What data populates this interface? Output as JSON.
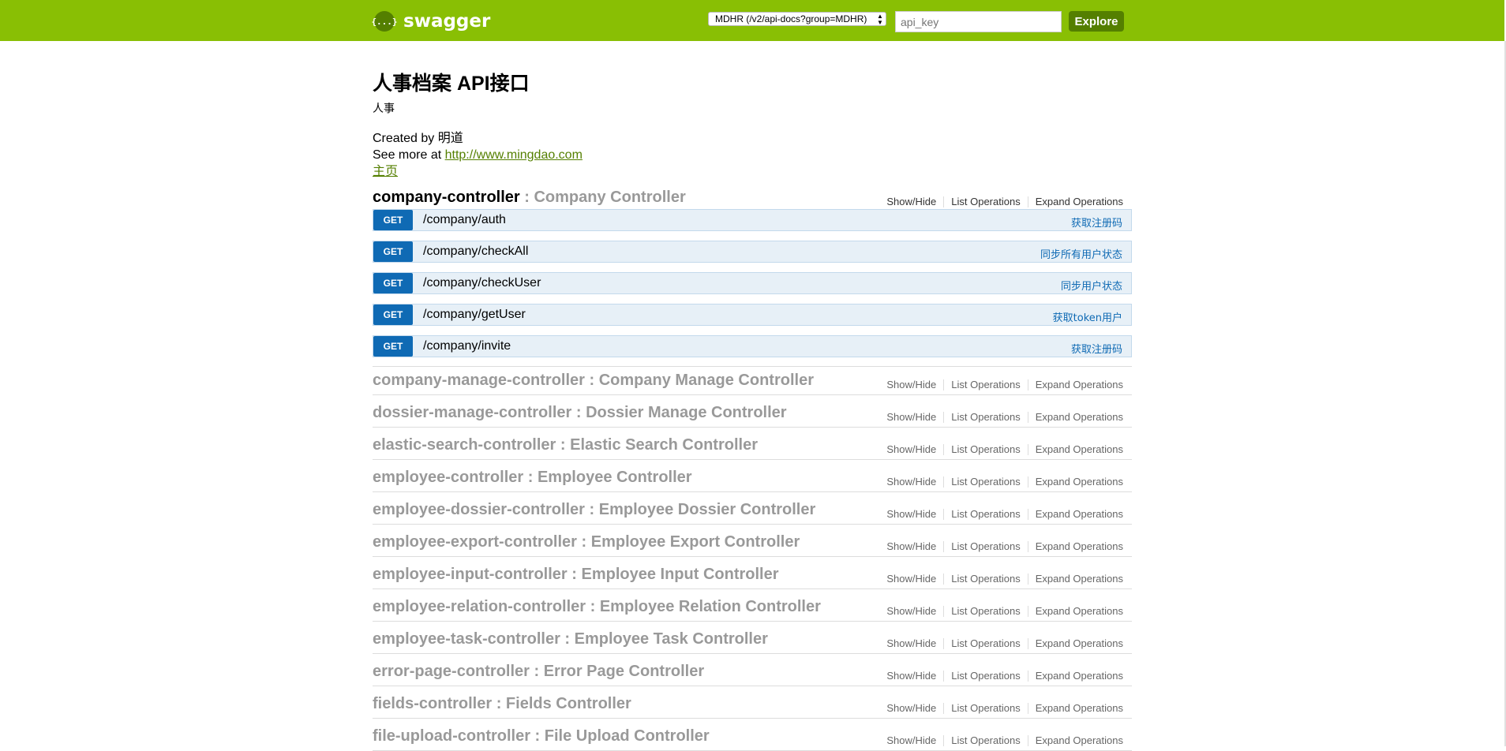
{
  "header": {
    "logo_icon": "{...}",
    "logo_text": "swagger",
    "spec_select": "MDHR (/v2/api-docs?group=MDHR)",
    "api_key_placeholder": "api_key",
    "explore_label": "Explore",
    "colors": {
      "bar": "#89bf04",
      "accent": "#547f00"
    }
  },
  "info": {
    "title": "人事档案 API接口",
    "description": "人事",
    "created_by": "Created by 明道",
    "see_more_prefix": "See more at ",
    "see_more_link": "http://www.mingdao.com",
    "home_link": "主页"
  },
  "options": {
    "show_hide": "Show/Hide",
    "list_operations": "List Operations",
    "expand_operations": "Expand Operations"
  },
  "resources": [
    {
      "name": "company-controller",
      "sep": " : ",
      "desc": "Company Controller",
      "operations": [
        {
          "method": "GET",
          "path": "/company/auth",
          "summary": "获取注册码"
        },
        {
          "method": "GET",
          "path": "/company/checkAll",
          "summary": "同步所有用户状态"
        },
        {
          "method": "GET",
          "path": "/company/checkUser",
          "summary": "同步用户状态"
        },
        {
          "method": "GET",
          "path": "/company/getUser",
          "summary": "获取token用户"
        },
        {
          "method": "GET",
          "path": "/company/invite",
          "summary": "获取注册码"
        }
      ]
    },
    {
      "name": "company-manage-controller",
      "sep": " : ",
      "desc": "Company Manage Controller"
    },
    {
      "name": "dossier-manage-controller",
      "sep": " : ",
      "desc": "Dossier Manage Controller"
    },
    {
      "name": "elastic-search-controller",
      "sep": " : ",
      "desc": "Elastic Search Controller"
    },
    {
      "name": "employee-controller",
      "sep": " : ",
      "desc": "Employee Controller"
    },
    {
      "name": "employee-dossier-controller",
      "sep": " : ",
      "desc": "Employee Dossier Controller"
    },
    {
      "name": "employee-export-controller",
      "sep": " : ",
      "desc": "Employee Export Controller"
    },
    {
      "name": "employee-input-controller",
      "sep": " : ",
      "desc": "Employee Input Controller"
    },
    {
      "name": "employee-relation-controller",
      "sep": " : ",
      "desc": "Employee Relation Controller"
    },
    {
      "name": "employee-task-controller",
      "sep": " : ",
      "desc": "Employee Task Controller"
    },
    {
      "name": "error-page-controller",
      "sep": " : ",
      "desc": "Error Page Controller"
    },
    {
      "name": "fields-controller",
      "sep": " : ",
      "desc": "Fields Controller"
    },
    {
      "name": "file-upload-controller",
      "sep": " : ",
      "desc": "File Upload Controller"
    }
  ]
}
